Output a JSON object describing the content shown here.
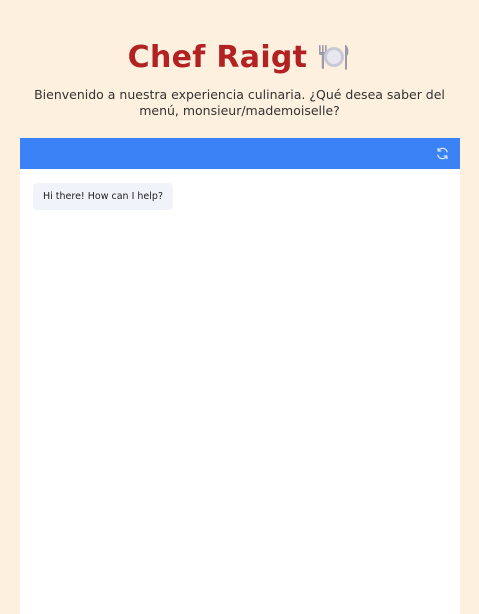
{
  "header": {
    "title": "Chef Raigt",
    "title_icon": "fork-plate-knife-icon",
    "subtitle": "Bienvenido a nuestra experiencia culinaria. ¿Qué desea saber del menú, monsieur/mademoiselle?"
  },
  "chat": {
    "topbar_color": "#3b82f6",
    "refresh_icon": "refresh-icon",
    "messages": [
      {
        "role": "bot",
        "text": "Hi there! How can I help?"
      }
    ]
  },
  "colors": {
    "page_background": "#fdf0df",
    "title": "#b22222",
    "bubble_background": "#f1f3fb"
  }
}
